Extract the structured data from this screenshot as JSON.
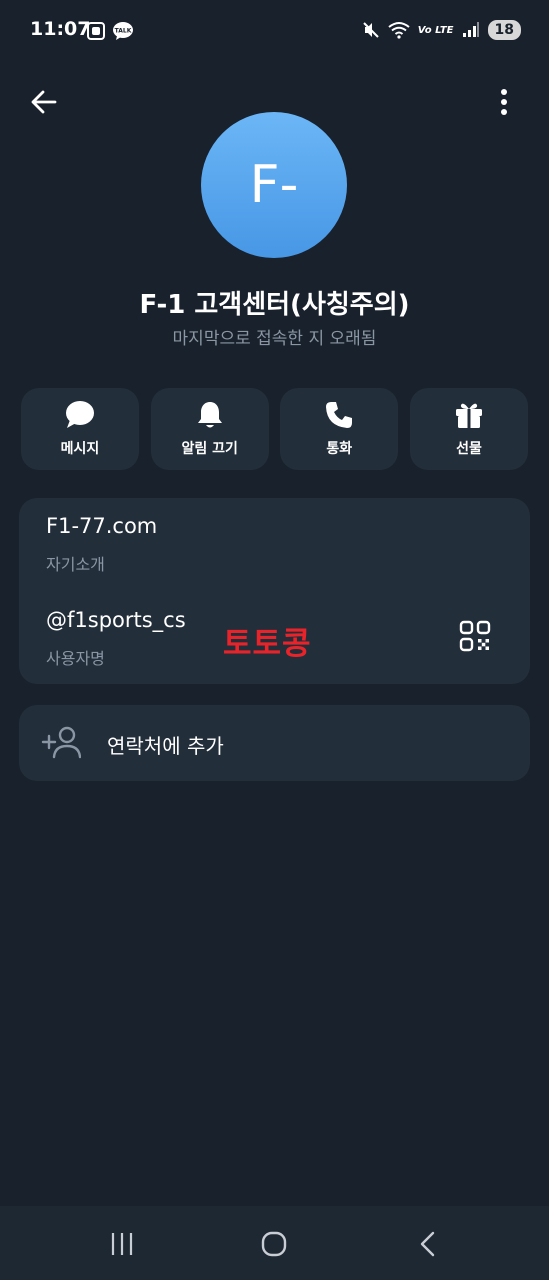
{
  "status_bar": {
    "time": "11:07",
    "talk_badge": "TALK",
    "network": "Vo LTE",
    "battery": "18"
  },
  "profile": {
    "avatar_initials": "F-",
    "avatar_color": "#4d9de8",
    "name": "F-1 고객센터(사칭주의)",
    "last_seen": "마지막으로 접속한 지 오래됨"
  },
  "actions": [
    {
      "label": "메시지",
      "icon": "chat-bubble-icon"
    },
    {
      "label": "알림 끄기",
      "icon": "bell-icon"
    },
    {
      "label": "통화",
      "icon": "phone-icon"
    },
    {
      "label": "선물",
      "icon": "gift-icon"
    }
  ],
  "info": {
    "bio_value": "F1-77.com",
    "bio_label": "자기소개",
    "username_value": "@f1sports_cs",
    "username_label": "사용자명",
    "watermark": "토토콩"
  },
  "add_contact": {
    "label": "연락처에 추가"
  },
  "colors": {
    "background": "#18212c",
    "card": "#232e3b",
    "secondary_text": "#8a96a3",
    "watermark": "#e8242a"
  }
}
